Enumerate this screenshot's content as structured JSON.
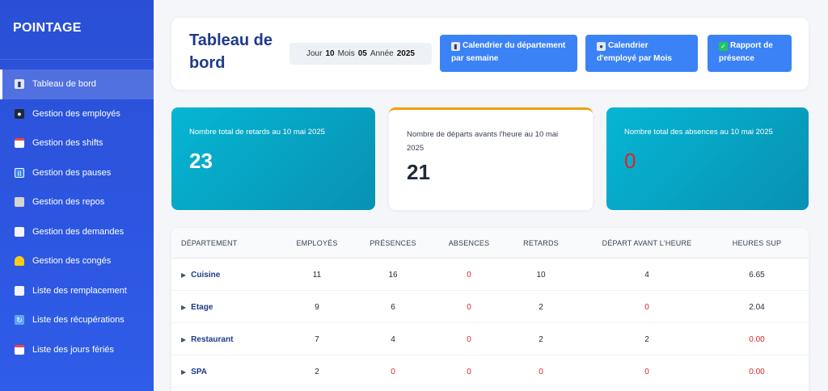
{
  "app": {
    "brand": "POINTAGE"
  },
  "sidebar": {
    "items": [
      {
        "label": "Tableau de bord",
        "icon": "chart-icon",
        "active": true
      },
      {
        "label": "Gestion des employés",
        "icon": "employee-icon"
      },
      {
        "label": "Gestion des shifts",
        "icon": "calendar-icon"
      },
      {
        "label": "Gestion des pauses",
        "icon": "pause-icon"
      },
      {
        "label": "Gestion des repos",
        "icon": "clipboard-icon"
      },
      {
        "label": "Gestion des demandes",
        "icon": "document-icon"
      },
      {
        "label": "Gestion des congés",
        "icon": "bell-icon"
      },
      {
        "label": "Liste des remplacement",
        "icon": "document-icon"
      },
      {
        "label": "Liste des récupérations",
        "icon": "refresh-icon"
      },
      {
        "label": "Liste des jours fériés",
        "icon": "calendar-icon"
      }
    ]
  },
  "header": {
    "title": "Tableau de bord",
    "date": {
      "day_label": "Jour",
      "day": "10",
      "month_label": "Mois",
      "month": "05",
      "year_label": "Année",
      "year": "2025"
    },
    "buttons": [
      {
        "label": "Calendrier du département par semaine",
        "icon": "chart-icon"
      },
      {
        "label": "Calendrier d'employé par Mois",
        "icon": "employee-icon"
      },
      {
        "label": "Rapport de présence",
        "icon": "checkmark-icon"
      }
    ]
  },
  "stats": [
    {
      "label": "Nombre total de retards au 10 mai 2025",
      "value": "23"
    },
    {
      "label": "Nombre de départs avants l'heure au 10 mai 2025",
      "value": "21"
    },
    {
      "label": "Nombre total des absences au 10 mai 2025",
      "value": "0"
    }
  ],
  "table": {
    "headers": [
      "DÉPARTEMENT",
      "EMPLOYÉS",
      "PRÉSENCES",
      "ABSENCES",
      "RETARDS",
      "DÉPART AVANT L'HEURE",
      "HEURES SUP"
    ],
    "rows": [
      {
        "dept": "Cuisine",
        "employes": "11",
        "presences": "16",
        "absences": "0",
        "retards": "10",
        "depart": "4",
        "heures_sup": "6.65"
      },
      {
        "dept": "Etage",
        "employes": "9",
        "presences": "6",
        "absences": "0",
        "retards": "2",
        "depart": "0",
        "heures_sup": "2.04"
      },
      {
        "dept": "Restaurant",
        "employes": "7",
        "presences": "4",
        "absences": "0",
        "retards": "2",
        "depart": "2",
        "heures_sup": "0.00"
      },
      {
        "dept": "SPA",
        "employes": "2",
        "presences": "0",
        "absences": "0",
        "retards": "0",
        "depart": "0",
        "heures_sup": "0.00"
      }
    ]
  },
  "colors": {
    "sidebar": "#2f5ce8",
    "accent": "#3b82f6",
    "title": "#1e3a8a",
    "teal": "#06b6d4",
    "danger": "#dc2626"
  }
}
